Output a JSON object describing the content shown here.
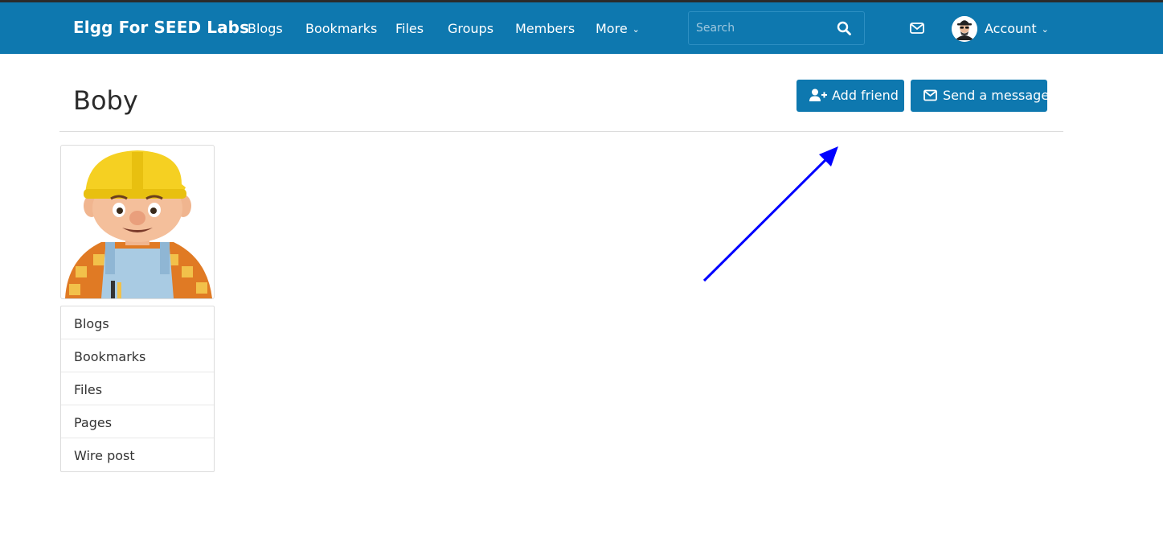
{
  "header": {
    "brand": "Elgg For SEED Labs",
    "nav": [
      {
        "label": "Blogs"
      },
      {
        "label": "Bookmarks"
      },
      {
        "label": "Files"
      },
      {
        "label": "Groups"
      },
      {
        "label": "Members"
      },
      {
        "label": "More"
      }
    ],
    "search": {
      "placeholder": "Search",
      "value": ""
    },
    "account_label": "Account",
    "icons": {
      "search": "search-icon",
      "mail": "envelope-icon",
      "avatar": "spy-avatar-icon",
      "caret": "chevron-down-icon"
    }
  },
  "profile": {
    "name": "Boby",
    "actions": {
      "add_friend": "Add friend",
      "send_message": "Send a message"
    },
    "owner_menu": [
      {
        "label": "Blogs"
      },
      {
        "label": "Bookmarks"
      },
      {
        "label": "Files"
      },
      {
        "label": "Pages"
      },
      {
        "label": "Wire post"
      }
    ]
  },
  "colors": {
    "brand_blue": "#0e78af",
    "annotation_arrow": "#0000ff"
  }
}
